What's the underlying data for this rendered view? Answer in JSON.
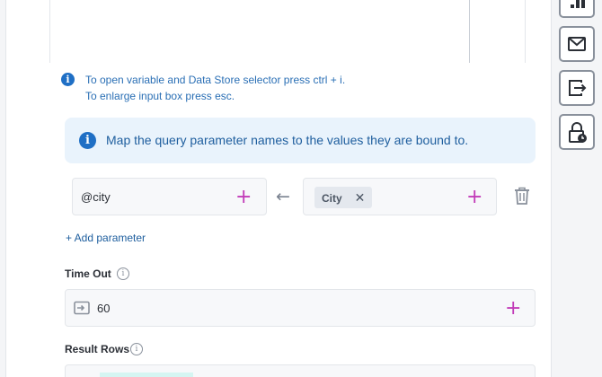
{
  "hint": {
    "line1": "To open variable and Data Store selector press ctrl + i.",
    "line2": "To enlarge input box press esc."
  },
  "banner": {
    "text": "Map the query parameter names to the values they are bound to."
  },
  "parameter": {
    "name": "@city",
    "value_chip": "City",
    "chip_remove": "✕"
  },
  "add_parameter_label": "+ Add parameter",
  "timeout": {
    "label": "Time Out",
    "value": "60"
  },
  "result_rows": {
    "label": "Result Rows"
  },
  "icons": {
    "plus": "+",
    "back_arrow": "←",
    "info": "i"
  },
  "colors": {
    "accent_plus": "#c23bb8",
    "link": "#1e5e9e",
    "banner_bg": "#e9f3fc",
    "info_blue": "#1f6fc5"
  }
}
